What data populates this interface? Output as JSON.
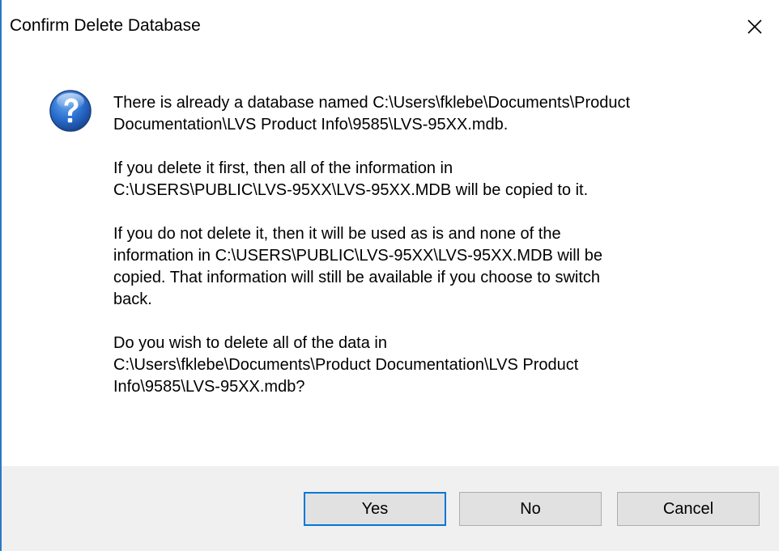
{
  "window": {
    "title": "Confirm Delete Database",
    "close_icon": "close-icon"
  },
  "message": {
    "icon": "question-icon",
    "paragraphs": [
      "There is already a database named C:\\Users\\fklebe\\Documents\\Product\nDocumentation\\LVS Product Info\\9585\\LVS-95XX.mdb.",
      "If you delete it first, then all of the information in\nC:\\USERS\\PUBLIC\\LVS-95XX\\LVS-95XX.MDB will be copied to it.",
      "If you do not delete it, then it will be used as is and none of the\ninformation in C:\\USERS\\PUBLIC\\LVS-95XX\\LVS-95XX.MDB will be\ncopied.  That information will still be available if you choose to switch\nback.",
      "Do you wish to delete all of the data in\nC:\\Users\\fklebe\\Documents\\Product Documentation\\LVS Product\nInfo\\9585\\LVS-95XX.mdb?"
    ]
  },
  "buttons": {
    "yes": "Yes",
    "no": "No",
    "cancel": "Cancel"
  },
  "colors": {
    "accent": "#0078d7",
    "window_border": "#2b78c6",
    "footer_bg": "#f0f0f0",
    "button_bg": "#e1e1e1"
  }
}
